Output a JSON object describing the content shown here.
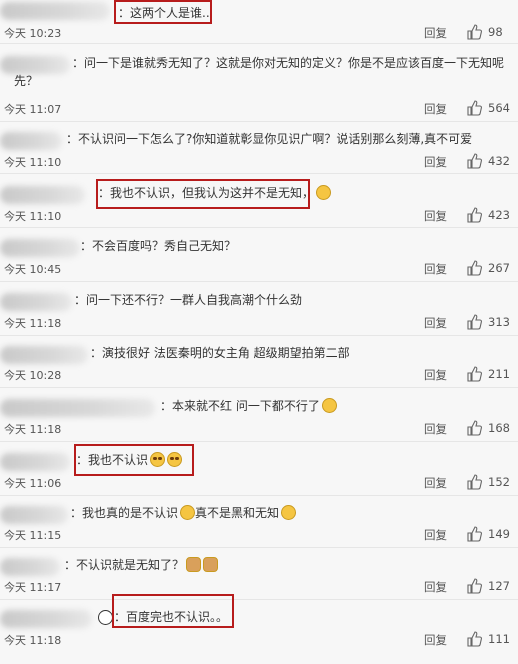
{
  "reply_label": "回复",
  "comments": [
    {
      "text": "：这两个人是谁..",
      "time": "今天 10:23",
      "likes": "98"
    },
    {
      "text": "：问一下是谁就秀无知了？这就是你对无知的定义？你是不是应该百度一下无知呢先？",
      "time": "今天 11:07",
      "likes": "564"
    },
    {
      "text": "：不认识问一下怎么了?你知道就彰显你见识广啊？说话别那么刻薄,真不可爱",
      "time": "今天 11:10",
      "likes": "432"
    },
    {
      "text": "：我也不认识，但我认为这并不是无知，",
      "time": "今天 11:10",
      "likes": "423"
    },
    {
      "text": "：不会百度吗？秀自己无知？",
      "time": "今天 10:45",
      "likes": "267"
    },
    {
      "text": "：问一下还不行？一群人自我高潮个什么劲",
      "time": "今天 11:18",
      "likes": "313"
    },
    {
      "text": "：演技很好 法医秦明的女主角 超级期望拍第二部",
      "time": "今天 10:28",
      "likes": "211"
    },
    {
      "text": "：本来就不红 问一下都不行了",
      "time": "今天 11:18",
      "likes": "168"
    },
    {
      "text": "：我也不认识",
      "time": "今天 11:06",
      "likes": "152"
    },
    {
      "text": "：我也真的是不认识",
      "text2": "真不是黑和无知",
      "time": "今天 11:15",
      "likes": "149"
    },
    {
      "text": "：不认识就是无知了？",
      "time": "今天 11:17",
      "likes": "127"
    },
    {
      "text": "：百度完也不认识。。",
      "time": "今天 11:18",
      "likes": "111"
    }
  ]
}
